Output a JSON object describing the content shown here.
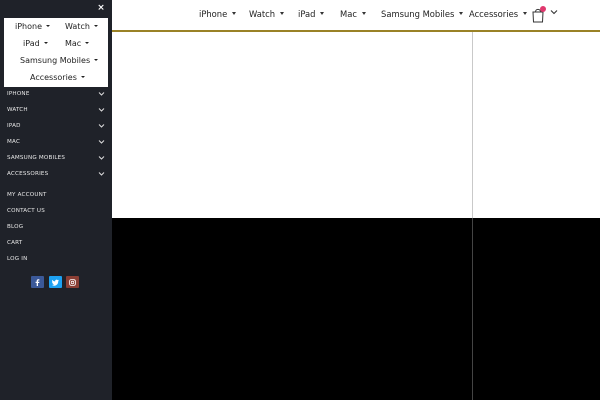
{
  "top_nav": {
    "items": [
      {
        "label": "iPhone"
      },
      {
        "label": "Watch"
      },
      {
        "label": "iPad"
      },
      {
        "label": "Mac"
      },
      {
        "label": "Samsung Mobiles"
      },
      {
        "label": "Accessories"
      }
    ],
    "cart_icon": "shopping-bag-icon",
    "chevron_icon": "chevron-down-icon"
  },
  "side_panel": {
    "close_label": "×",
    "dropdown_items": [
      {
        "label": "iPhone"
      },
      {
        "label": "Watch"
      },
      {
        "label": "iPad"
      },
      {
        "label": "Mac"
      },
      {
        "label": "Samsung Mobiles"
      },
      {
        "label": "Accessories"
      }
    ],
    "menu_items": [
      {
        "label": "IPHONE"
      },
      {
        "label": "WATCH"
      },
      {
        "label": "IPAD"
      },
      {
        "label": "MAC"
      },
      {
        "label": "SAMSUNG MOBILES"
      },
      {
        "label": "ACCESSORIES"
      }
    ],
    "links": [
      {
        "label": "MY ACCOUNT"
      },
      {
        "label": "CONTACT US"
      },
      {
        "label": "BLOG"
      },
      {
        "label": "CART"
      },
      {
        "label": "LOG IN"
      }
    ],
    "social": [
      {
        "icon": "facebook-icon",
        "color": "#3b5998"
      },
      {
        "icon": "twitter-icon",
        "color": "#1da1f2"
      },
      {
        "icon": "instagram-icon",
        "color": "#8a3e34"
      }
    ]
  },
  "colors": {
    "accent_gold": "#9a8226",
    "panel_bg": "#1f2229",
    "cart_badge": "#e0386e"
  }
}
